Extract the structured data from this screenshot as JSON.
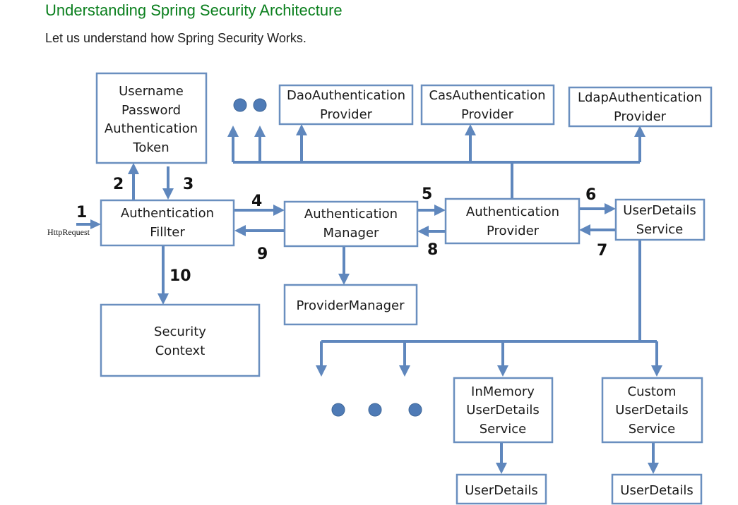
{
  "header": {
    "title": "Understanding Spring Security Architecture",
    "subtitle": "Let us understand how Spring Security Works."
  },
  "diagram": {
    "boxes": {
      "upat": [
        "Username",
        "Password",
        "Authentication",
        "Token"
      ],
      "auth_filter": [
        "Authentication",
        "Fillter"
      ],
      "auth_manager": [
        "Authentication",
        "Manager"
      ],
      "auth_provider": [
        "Authentication",
        "Provider"
      ],
      "uds": [
        "UserDetails",
        "Service"
      ],
      "provider_manager": [
        "ProviderManager"
      ],
      "security_context": [
        "Security",
        "Context"
      ],
      "dao_provider": [
        "DaoAuthentication",
        "Provider"
      ],
      "cas_provider": [
        "CasAuthentication",
        "Provider"
      ],
      "ldap_provider": [
        "LdapAuthentication",
        "Provider"
      ],
      "inmemory_uds": [
        "InMemory",
        "UserDetails",
        "Service"
      ],
      "custom_uds": [
        "Custom",
        "UserDetails",
        "Service"
      ],
      "userdetails_1": [
        "UserDetails"
      ],
      "userdetails_2": [
        "UserDetails"
      ]
    },
    "step_labels": {
      "s1": "1",
      "s2": "2",
      "s3": "3",
      "s4": "4",
      "s5": "5",
      "s6": "6",
      "s7": "7",
      "s8": "8",
      "s9": "9",
      "s10": "10"
    },
    "http_request_label": "HttpRequest"
  },
  "colors": {
    "title": "#0a7f1d",
    "arrow": "#5f87bd",
    "box_border": "#6a8fbf"
  }
}
